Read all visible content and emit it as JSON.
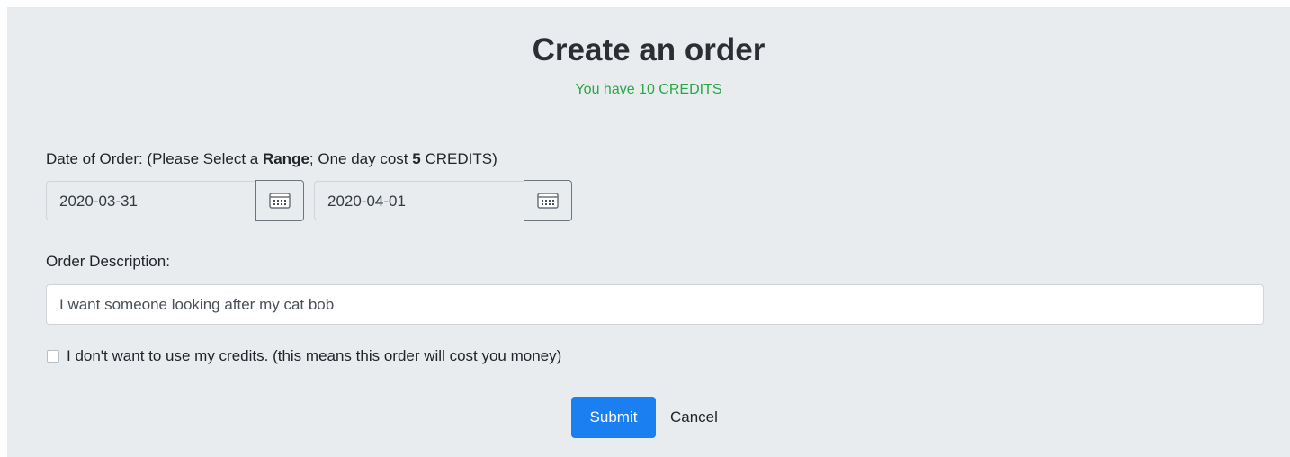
{
  "form": {
    "title": "Create an order",
    "credits_text": "You have 10 CREDITS",
    "date_label": {
      "prefix": "Date of Order: (Please Select a ",
      "range_word": "Range",
      "middle": "; One day cost ",
      "cost_number": "5",
      "suffix": " CREDITS)"
    },
    "start_date": "2020-03-31",
    "end_date": "2020-04-01",
    "calendar_icon": "calendar-icon",
    "description_label": "Order Description:",
    "description_value": "I want someone looking after my cat bob",
    "no_credits_checkbox_label": "I don't want to use my credits. (this means this order will cost you money)",
    "no_credits_checked": false,
    "submit_label": "Submit",
    "cancel_label": "Cancel"
  },
  "colors": {
    "panel_background": "#e9ecef",
    "credits_text": "#28a745",
    "submit_button": "#1a7ff0"
  }
}
